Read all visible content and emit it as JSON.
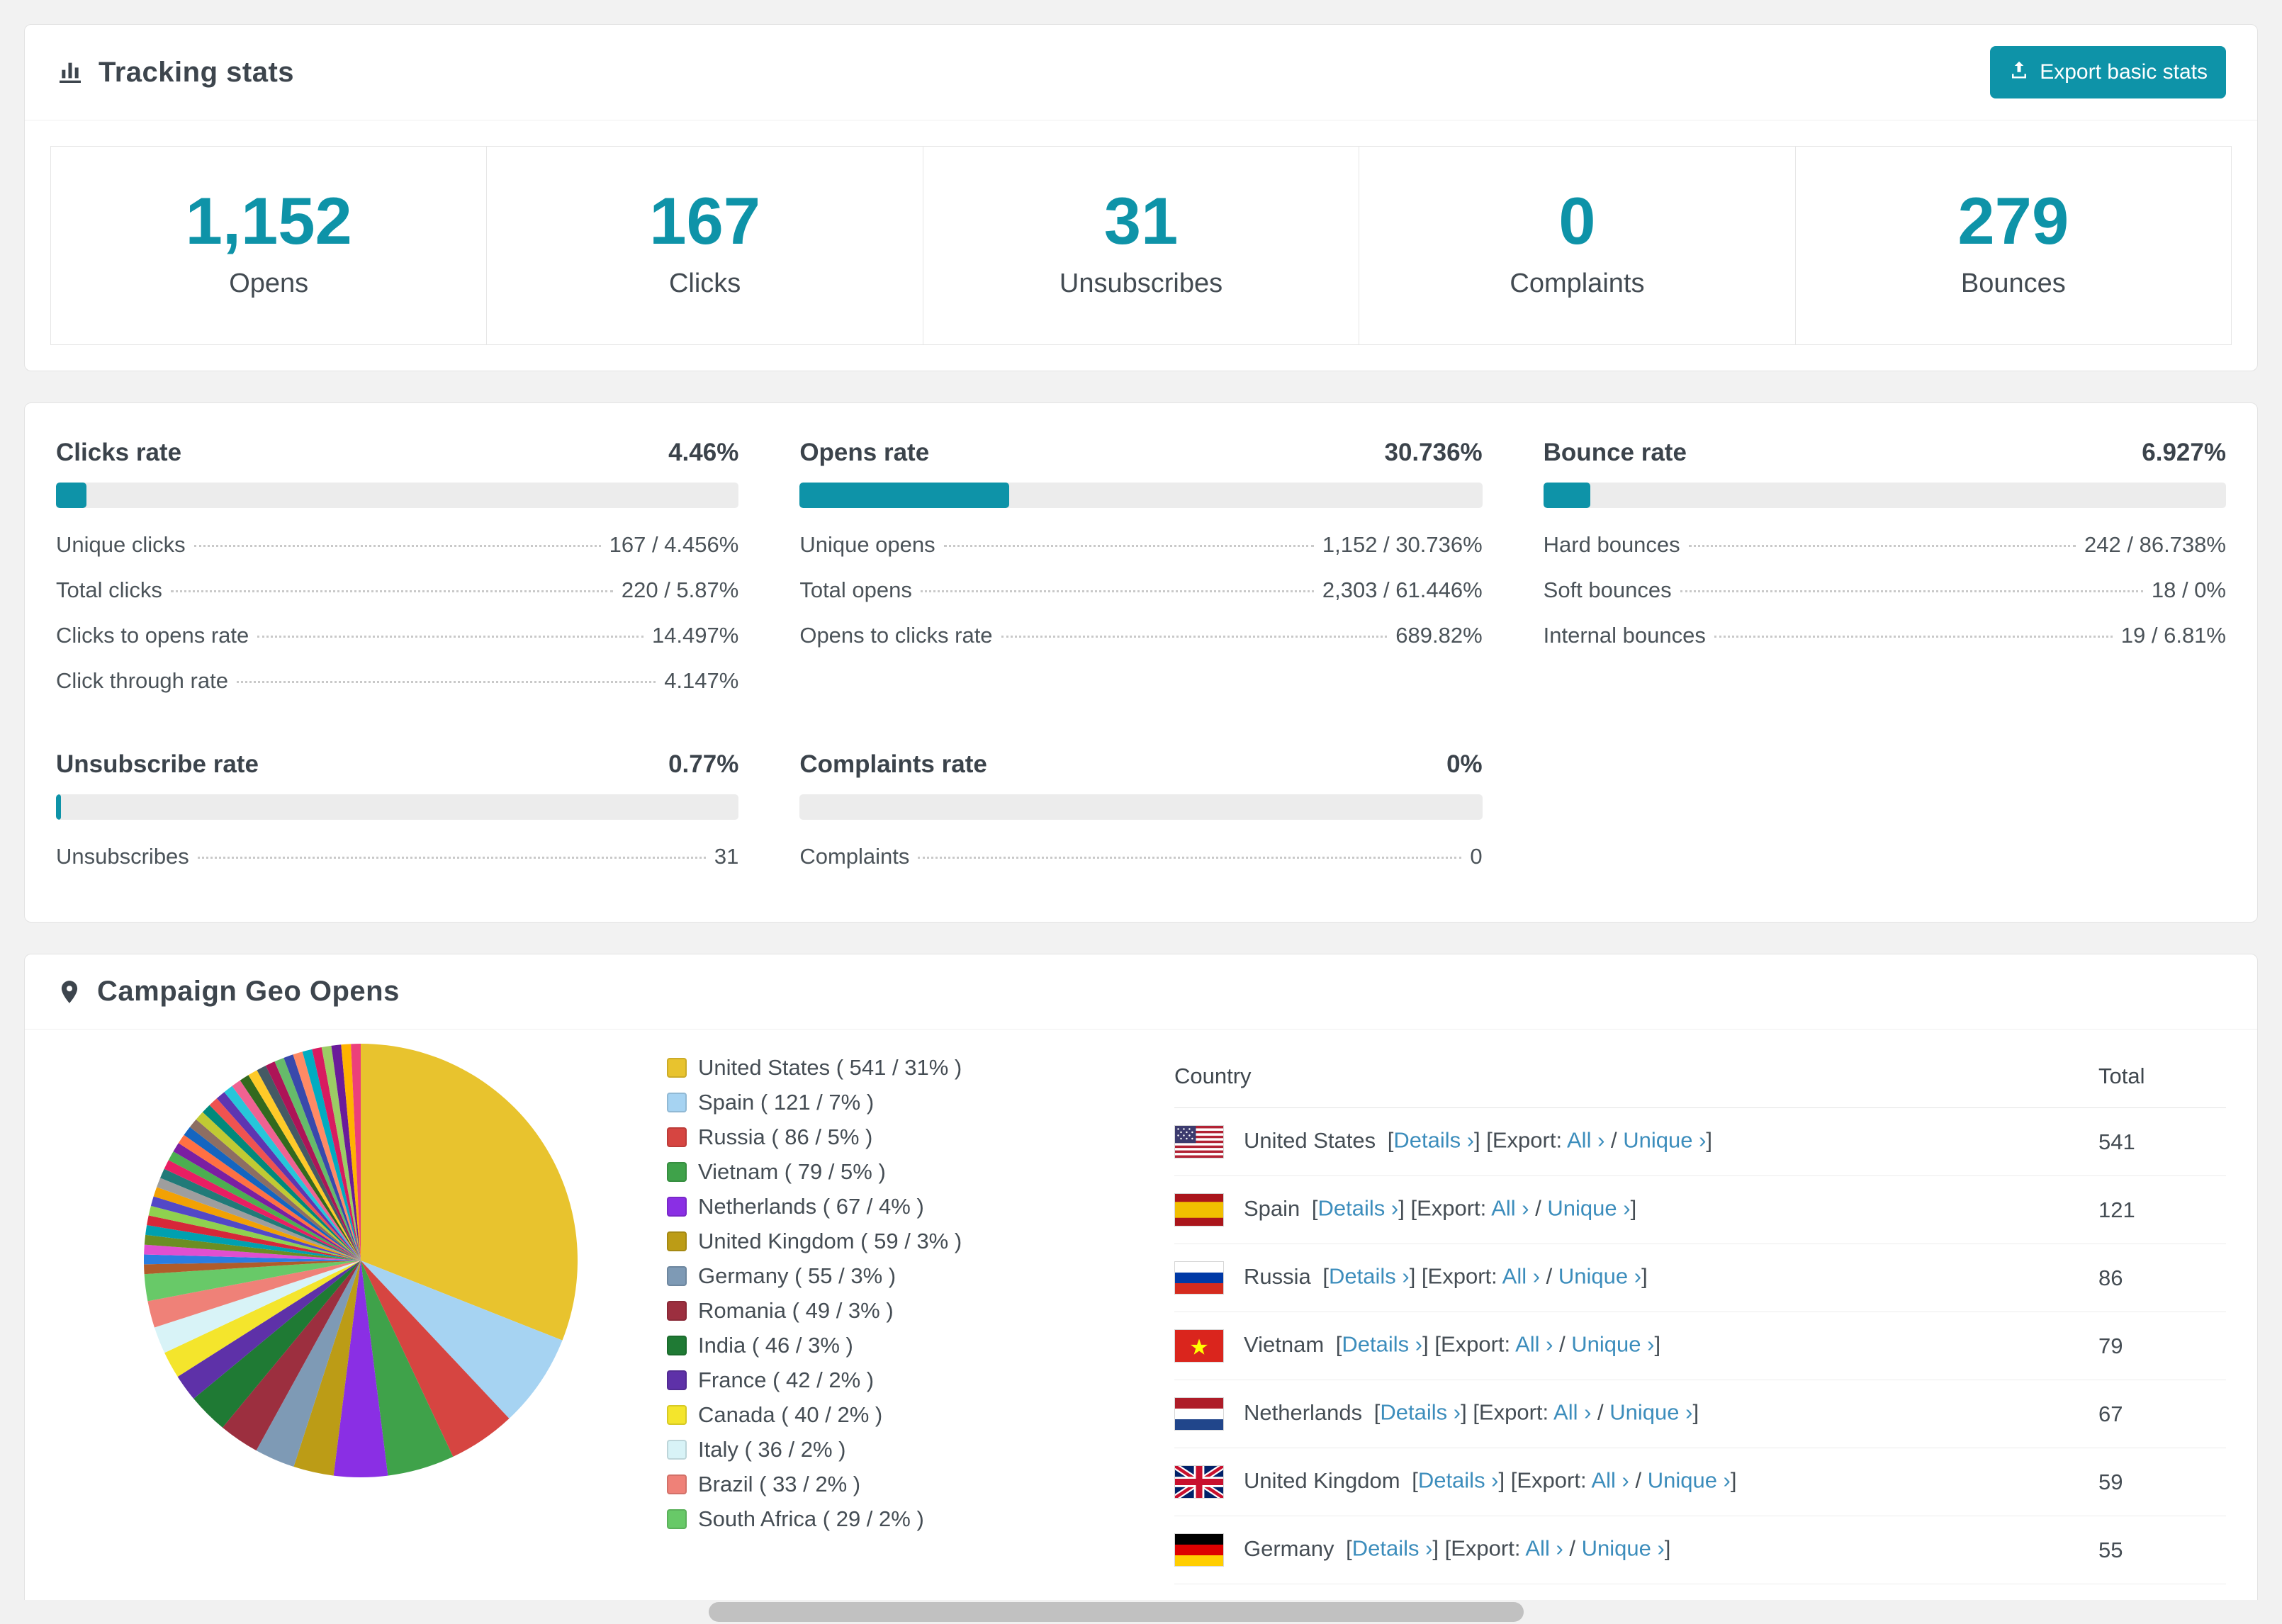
{
  "colors": {
    "accent": "#0e93a8",
    "link": "#3c8dbc",
    "bar_track": "#ececec"
  },
  "tracking": {
    "title": "Tracking stats",
    "export_label": "Export basic stats",
    "stats": [
      {
        "value": "1,152",
        "label": "Opens"
      },
      {
        "value": "167",
        "label": "Clicks"
      },
      {
        "value": "31",
        "label": "Unsubscribes"
      },
      {
        "value": "0",
        "label": "Complaints"
      },
      {
        "value": "279",
        "label": "Bounces"
      }
    ]
  },
  "rates": [
    {
      "title": "Clicks rate",
      "value": "4.46%",
      "percent": 4.46,
      "rows": [
        {
          "label": "Unique clicks",
          "value": "167 / 4.456%"
        },
        {
          "label": "Total clicks",
          "value": "220 / 5.87%"
        },
        {
          "label": "Clicks to opens rate",
          "value": "14.497%"
        },
        {
          "label": "Click through rate",
          "value": "4.147%"
        }
      ]
    },
    {
      "title": "Opens rate",
      "value": "30.736%",
      "percent": 30.736,
      "rows": [
        {
          "label": "Unique opens",
          "value": "1,152 / 30.736%"
        },
        {
          "label": "Total opens",
          "value": "2,303 / 61.446%"
        },
        {
          "label": "Opens to clicks rate",
          "value": "689.82%"
        }
      ]
    },
    {
      "title": "Bounce rate",
      "value": "6.927%",
      "percent": 6.927,
      "rows": [
        {
          "label": "Hard bounces",
          "value": "242 / 86.738%"
        },
        {
          "label": "Soft bounces",
          "value": "18 / 0%"
        },
        {
          "label": "Internal bounces",
          "value": "19 / 6.81%"
        }
      ]
    },
    {
      "title": "Unsubscribe rate",
      "value": "0.77%",
      "percent": 0.77,
      "rows": [
        {
          "label": "Unsubscribes",
          "value": "31"
        }
      ]
    },
    {
      "title": "Complaints rate",
      "value": "0%",
      "percent": 0,
      "rows": [
        {
          "label": "Complaints",
          "value": "0"
        }
      ]
    }
  ],
  "geo": {
    "title": "Campaign Geo Opens",
    "chart_data": {
      "type": "pie",
      "title": "Campaign Geo Opens",
      "legend_position": "right",
      "series": [
        {
          "name": "United States",
          "value": 541,
          "percent": 31,
          "color": "#e8c32e"
        },
        {
          "name": "Spain",
          "value": 121,
          "percent": 7,
          "color": "#a6d3f2"
        },
        {
          "name": "Russia",
          "value": 86,
          "percent": 5,
          "color": "#d64541"
        },
        {
          "name": "Vietnam",
          "value": 79,
          "percent": 5,
          "color": "#3fa24a"
        },
        {
          "name": "Netherlands",
          "value": 67,
          "percent": 4,
          "color": "#8a2fe4"
        },
        {
          "name": "United Kingdom",
          "value": 59,
          "percent": 3,
          "color": "#bc9c16"
        },
        {
          "name": "Germany",
          "value": 55,
          "percent": 3,
          "color": "#7e9ab5"
        },
        {
          "name": "Romania",
          "value": 49,
          "percent": 3,
          "color": "#9c2f3f"
        },
        {
          "name": "India",
          "value": 46,
          "percent": 3,
          "color": "#1f7a34"
        },
        {
          "name": "France",
          "value": 42,
          "percent": 2,
          "color": "#5e31a8"
        },
        {
          "name": "Canada",
          "value": 40,
          "percent": 2,
          "color": "#f4e52c"
        },
        {
          "name": "Italy",
          "value": 36,
          "percent": 2,
          "color": "#d8f3f7"
        },
        {
          "name": "Brazil",
          "value": 33,
          "percent": 2,
          "color": "#ef8178"
        },
        {
          "name": "South Africa",
          "value": 29,
          "percent": 2,
          "color": "#68c968"
        }
      ],
      "others_percent": 26,
      "other_colors": [
        "#b05c2a",
        "#2a7de1",
        "#e04fd0",
        "#6b8e23",
        "#00a0b0",
        "#d62739",
        "#8fd14f",
        "#5348c7",
        "#f2a104",
        "#9e9e9e",
        "#217a78",
        "#e91e63",
        "#4caf50",
        "#7b1fa2",
        "#ff7043",
        "#1565c0",
        "#8d6e63",
        "#c0ca33",
        "#00897b",
        "#ef5350",
        "#5e35b1",
        "#26c6da",
        "#f06292",
        "#33691e",
        "#ffca28",
        "#455a64",
        "#ad1457",
        "#66bb6a",
        "#3949ab",
        "#ff8a65",
        "#00acc1",
        "#d81b60",
        "#9ccc65",
        "#6a1b9a",
        "#ffb300",
        "#ec407a"
      ]
    },
    "table": {
      "headers": [
        "Country",
        "Total"
      ],
      "details_label": "Details ›",
      "export_prefix": "Export:",
      "all_label": "All ›",
      "unique_label": "Unique ›",
      "rows": [
        {
          "country": "United States",
          "flag": "us",
          "total": "541"
        },
        {
          "country": "Spain",
          "flag": "es",
          "total": "121"
        },
        {
          "country": "Russia",
          "flag": "ru",
          "total": "86"
        },
        {
          "country": "Vietnam",
          "flag": "vn",
          "total": "79"
        },
        {
          "country": "Netherlands",
          "flag": "nl",
          "total": "67"
        },
        {
          "country": "United Kingdom",
          "flag": "gb",
          "total": "59"
        },
        {
          "country": "Germany",
          "flag": "de",
          "total": "55"
        }
      ]
    }
  }
}
